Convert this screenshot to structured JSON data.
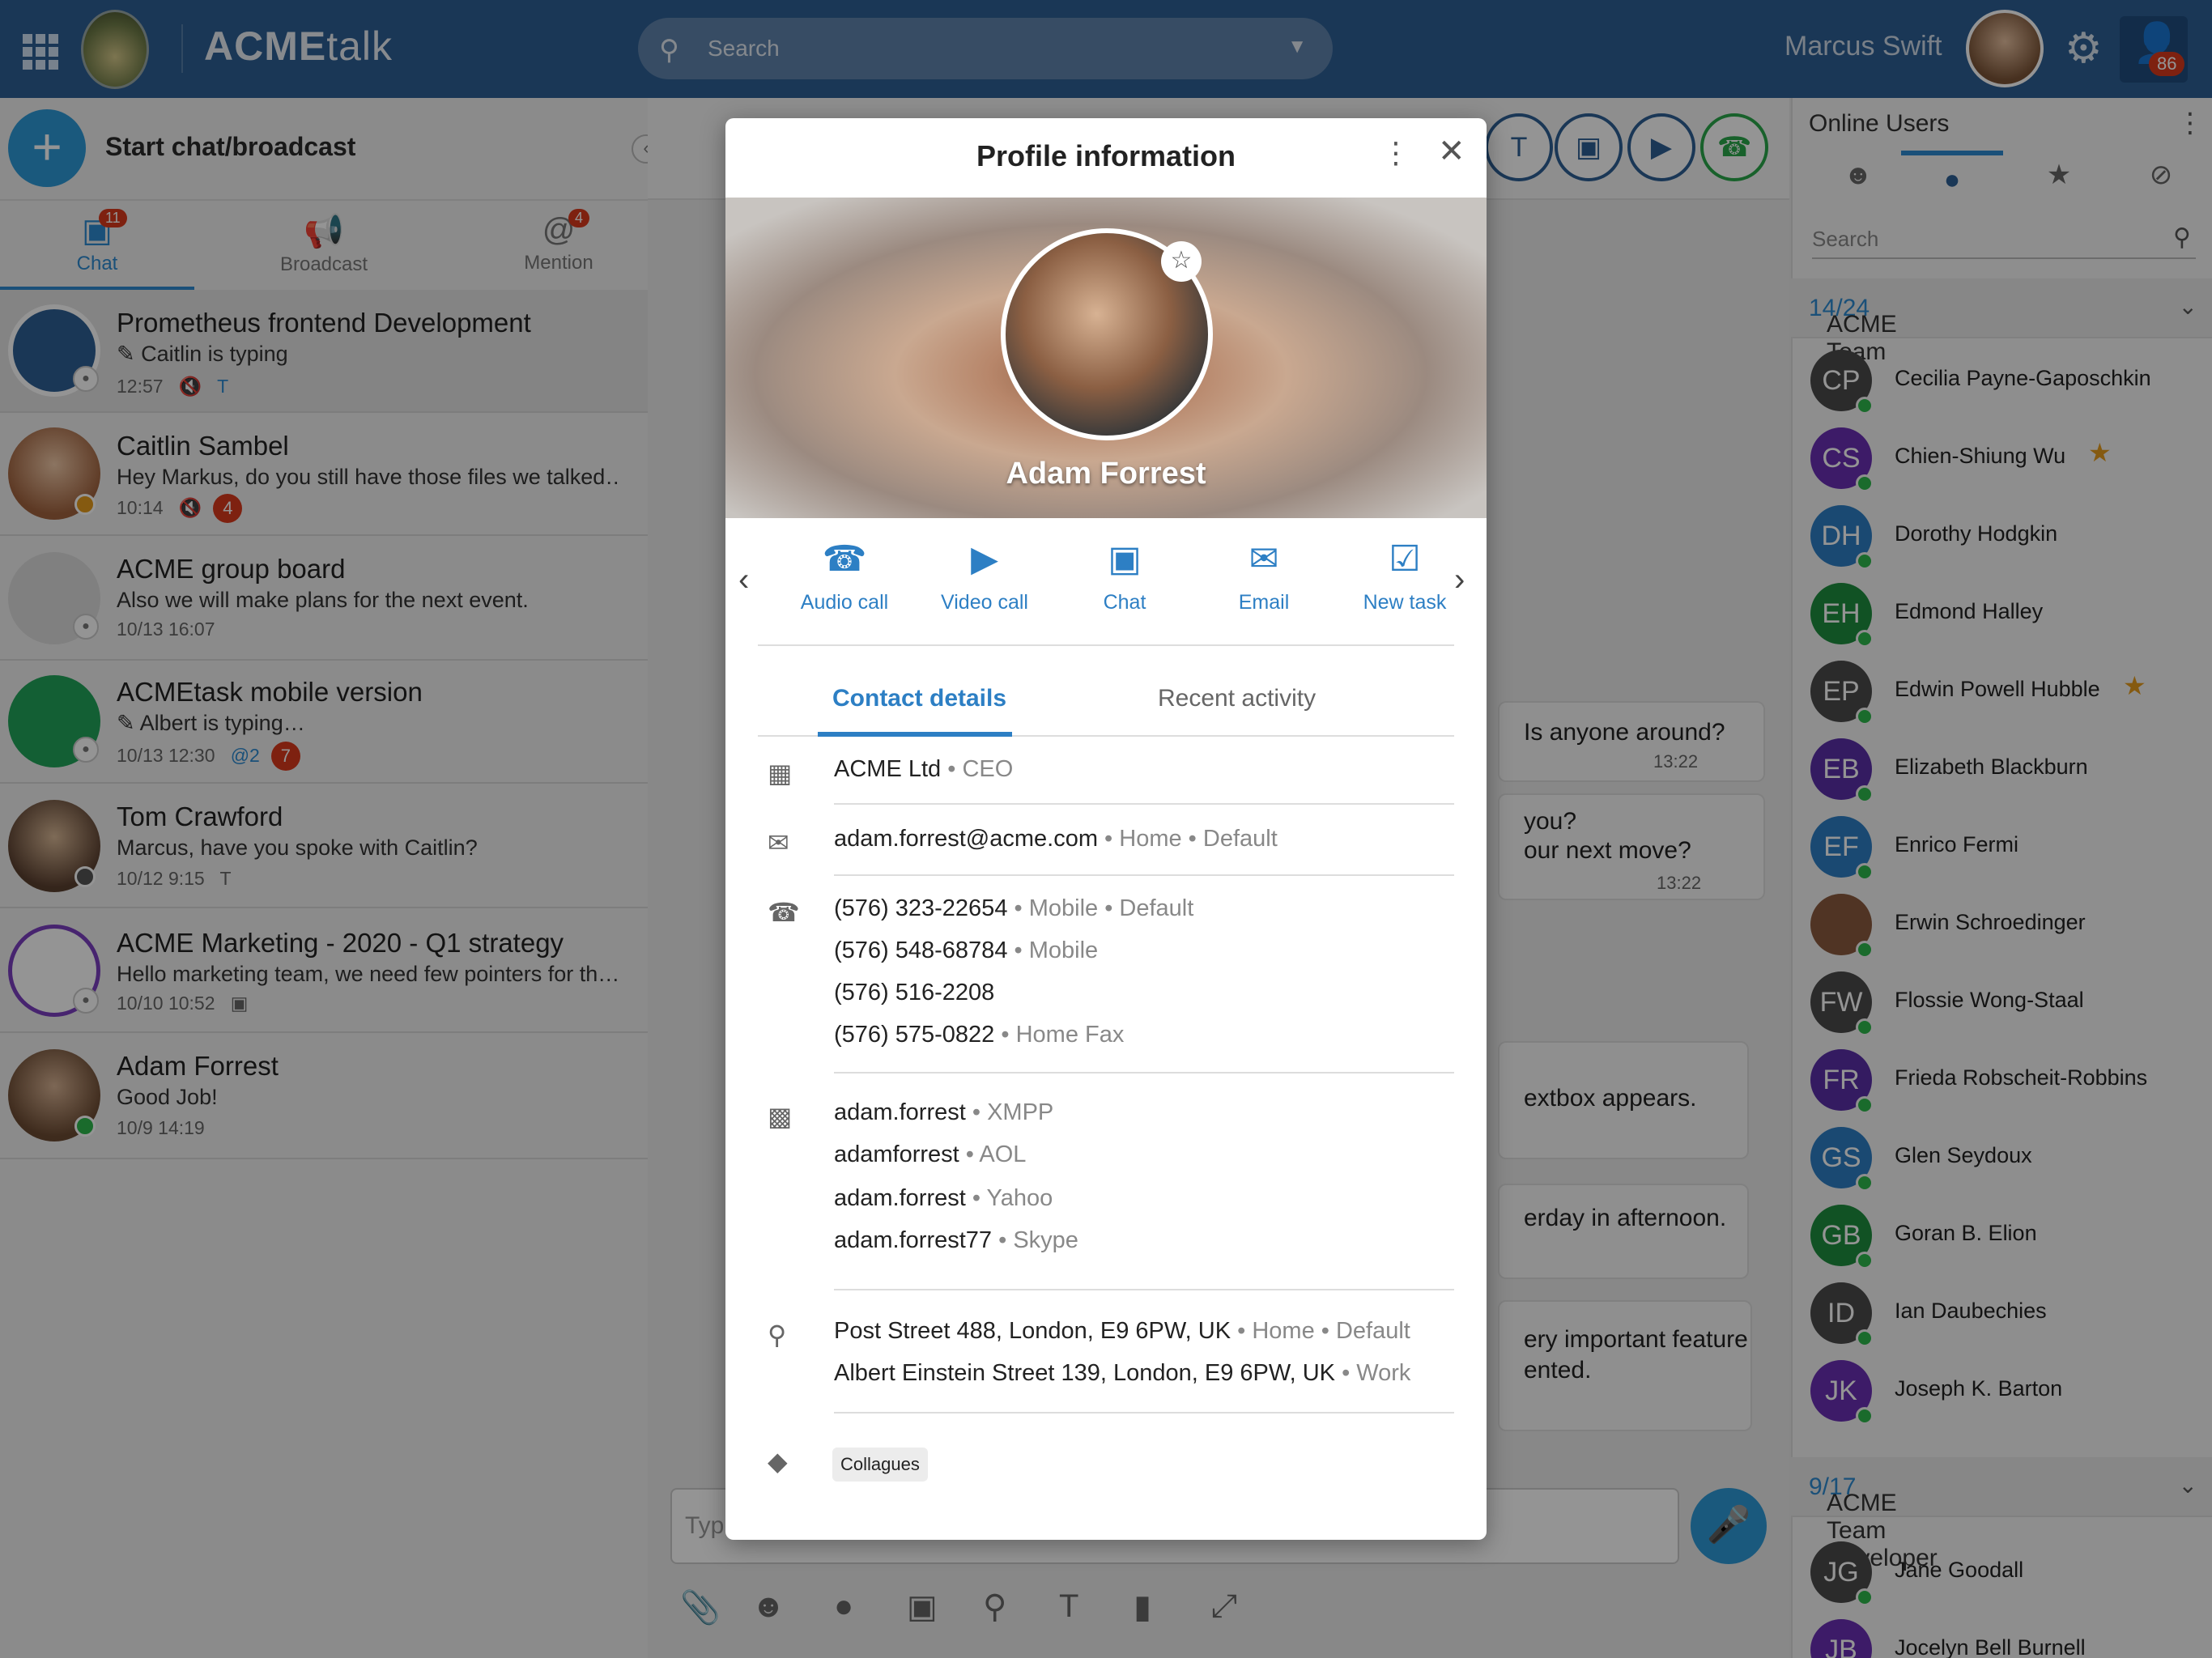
{
  "topbar": {
    "brand_bold": "ACME",
    "brand_rest": "talk",
    "search_placeholder": "Search",
    "username": "Marcus Swift",
    "notif_count": "86"
  },
  "left": {
    "start_label": "Start chat/broadcast",
    "tabs": [
      {
        "label": "Chat",
        "badge": "11"
      },
      {
        "label": "Broadcast",
        "badge": ""
      },
      {
        "label": "Mention",
        "badge": "4"
      }
    ],
    "chats": [
      {
        "name": "Prometheus frontend Development",
        "msg": "✎ Caitlin is typing",
        "time": "12:57",
        "badge": ""
      },
      {
        "name": "Caitlin Sambel",
        "msg": "Hey Markus, do you still have those files we talked…",
        "time": "10:14",
        "badge": "4"
      },
      {
        "name": "ACME group board",
        "msg": "Also we will make plans for the next event.",
        "time": "10/13  16:07",
        "badge": ""
      },
      {
        "name": "ACMEtask mobile version",
        "msg": "✎ Albert is typing…",
        "time": "10/13  12:30",
        "badge": "7",
        "mention": "@2"
      },
      {
        "name": "Tom Crawford",
        "msg": "Marcus, have you spoke with Caitlin?",
        "time": "10/12  9:15",
        "badge": ""
      },
      {
        "name": "ACME Marketing - 2020 - Q1 strategy",
        "msg": "Hello marketing team, we need few pointers for th…",
        "time": "10/10  10:52",
        "badge": ""
      },
      {
        "name": "Adam Forrest",
        "msg": "Good Job!",
        "time": "10/9  14:19",
        "badge": ""
      }
    ]
  },
  "middle": {
    "bubbles": [
      {
        "text": "Is anyone around?",
        "time": "13:22"
      },
      {
        "text": "you?",
        "text2": "our next move?",
        "time": "13:22"
      },
      {
        "text": "extbox appears."
      },
      {
        "text": "erday in afternoon."
      },
      {
        "text": "ery important feature",
        "text2": "ented."
      }
    ],
    "composer_placeholder": "Typ"
  },
  "right": {
    "title": "Online Users",
    "search_placeholder": "Search",
    "team1": {
      "name": "ACME Team",
      "count": "14/24"
    },
    "team2": {
      "name": "ACME Team Developer",
      "count": "9/17"
    },
    "users": [
      {
        "initials": "CP",
        "name": "Cecilia Payne-Gaposchkin",
        "color": "#4a4a4a",
        "star": false
      },
      {
        "initials": "CS",
        "name": "Chien-Shiung Wu",
        "color": "#6a2fb3",
        "star": true
      },
      {
        "initials": "DH",
        "name": "Dorothy Hodgkin",
        "color": "#2d7fc4",
        "star": false
      },
      {
        "initials": "EH",
        "name": "Edmond Halley",
        "color": "#1e8e3e",
        "star": false
      },
      {
        "initials": "EP",
        "name": "Edwin Powell Hubble",
        "color": "#4a4a4a",
        "star": true
      },
      {
        "initials": "EB",
        "name": "Elizabeth Blackburn",
        "color": "#5a2fa8",
        "star": false
      },
      {
        "initials": "EF",
        "name": "Enrico Fermi",
        "color": "#2d7fc4",
        "star": false
      },
      {
        "initials": "",
        "name": "Erwin Schroedinger",
        "color": "#8a5a3e",
        "star": false
      },
      {
        "initials": "FW",
        "name": "Flossie Wong-Staal",
        "color": "#4a4a4a",
        "star": false
      },
      {
        "initials": "FR",
        "name": "Frieda Robscheit-Robbins",
        "color": "#5a2fa8",
        "star": false
      },
      {
        "initials": "GS",
        "name": "Glen Seydoux",
        "color": "#2d7fc4",
        "star": false
      },
      {
        "initials": "GB",
        "name": "Goran B. Elion",
        "color": "#1e8e3e",
        "star": false
      },
      {
        "initials": "ID",
        "name": "Ian Daubechies",
        "color": "#4a4a4a",
        "star": false
      },
      {
        "initials": "JK",
        "name": "Joseph K. Barton",
        "color": "#6a2fb3",
        "star": false
      }
    ],
    "users2": [
      {
        "initials": "JG",
        "name": "Jane Goodall",
        "color": "#4a4a4a"
      },
      {
        "initials": "JB",
        "name": "Jocelyn Bell Burnell",
        "color": "#6a2fb3"
      }
    ]
  },
  "modal": {
    "title": "Profile information",
    "name": "Adam Forrest",
    "actions": [
      "Audio call",
      "Video call",
      "Chat",
      "Email",
      "New task"
    ],
    "tabs": [
      "Contact details",
      "Recent activity"
    ],
    "company": {
      "main": "ACME Ltd",
      "sub": " • CEO"
    },
    "email": {
      "main": "adam.forrest@acme.com",
      "sub": " • Home • Default"
    },
    "phones": [
      {
        "main": "(576) 323-22654",
        "sub": " • Mobile • Default"
      },
      {
        "main": "(576) 548-68784",
        "sub": " • Mobile"
      },
      {
        "main": "(576) 516-2208",
        "sub": ""
      },
      {
        "main": "(576) 575-0822",
        "sub": " • Home Fax"
      }
    ],
    "ims": [
      {
        "main": "adam.forrest",
        "sub": " • XMPP"
      },
      {
        "main": "adamforrest",
        "sub": " • AOL"
      },
      {
        "main": "adam.forrest",
        "sub": " • Yahoo"
      },
      {
        "main": "adam.forrest77",
        "sub": " • Skype"
      }
    ],
    "addresses": [
      {
        "main": "Post Street 488, London, E9 6PW, UK",
        "sub": " • Home • Default"
      },
      {
        "main": "Albert Einstein Street 139, London, E9 6PW, UK",
        "sub": " • Work"
      }
    ],
    "tag": "Collagues"
  }
}
